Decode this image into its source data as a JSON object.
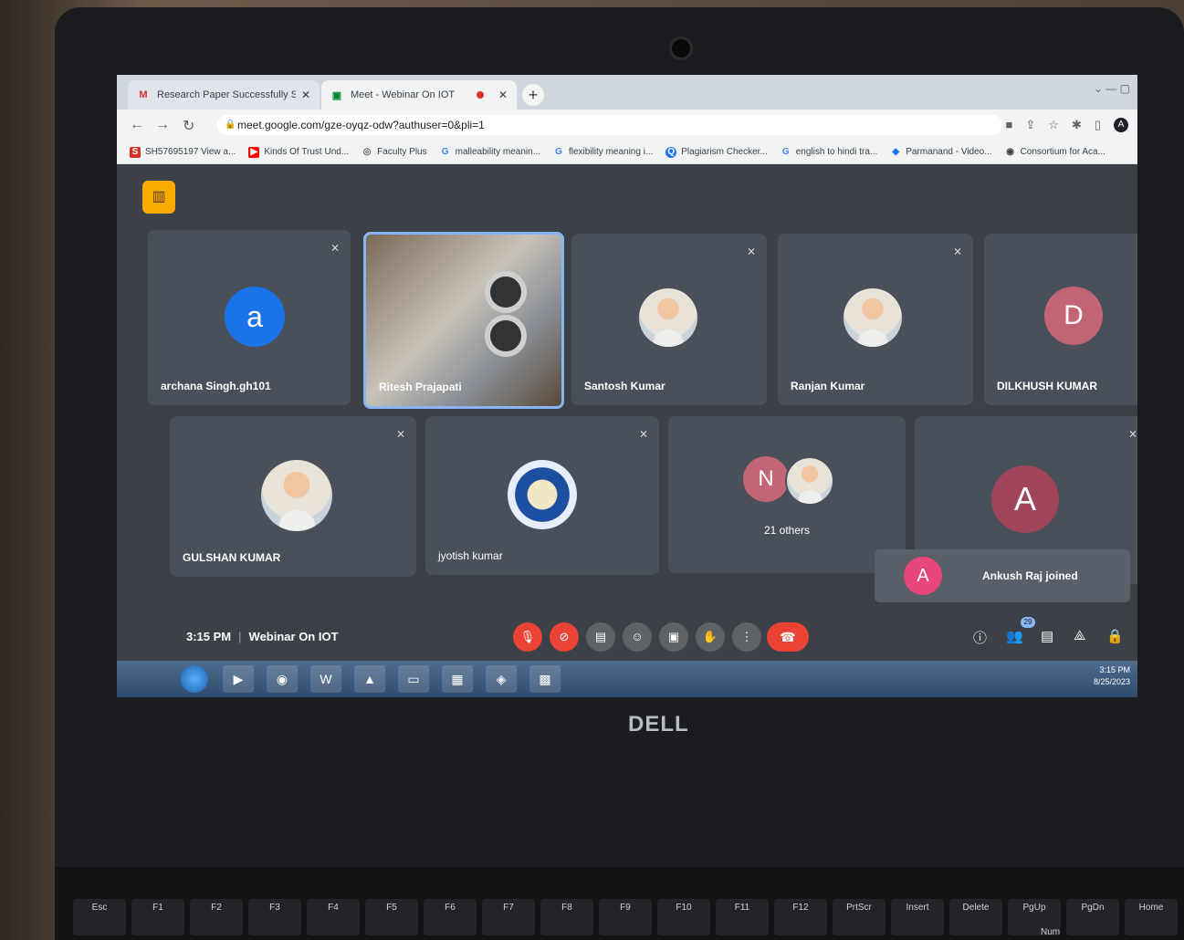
{
  "browser": {
    "tabs": [
      {
        "title": "Research Paper Successfully Sub",
        "icon": "gmail-icon",
        "active": false
      },
      {
        "title": "Meet - Webinar On IOT",
        "icon": "meet-icon",
        "active": true
      }
    ],
    "url": "meet.google.com/gze-oyqz-odw?authuser=0&pli=1",
    "profile_initial": "A",
    "bookmarks": [
      "SH57695197 View a...",
      "Kinds Of Trust Und...",
      "Faculty Plus",
      "malleability meanin...",
      "flexibility meaning i...",
      "Plagiarism Checker...",
      "english to hindi tra...",
      "Parmanand - Video...",
      "Consortium for Aca..."
    ]
  },
  "meet": {
    "participants": [
      {
        "name": "archana Singh.gh101",
        "initial": "a",
        "color": "#1a73e8"
      },
      {
        "name": "Ritesh Prajapati",
        "video": true
      },
      {
        "name": "Santosh Kumar",
        "photo": true
      },
      {
        "name": "Ranjan Kumar",
        "photo": true
      },
      {
        "name": "DILKHUSH KUMAR",
        "initial": "D",
        "color": "#c26577"
      },
      {
        "name": "GULSHAN KUMAR",
        "photo": true
      },
      {
        "name": "jyotish kumar",
        "photo": true
      },
      {
        "name": "21 others",
        "initial": "N",
        "color": "#c26577"
      },
      {
        "name": "",
        "initial": "A",
        "color": "#a0455a"
      }
    ],
    "toast": {
      "initial": "A",
      "text": "Ankush Raj joined",
      "color": "#e8457a"
    },
    "time": "3:15 PM",
    "meeting_title": "Webinar On IOT",
    "people_count": "29"
  },
  "taskbar": {
    "time": "3:15 PM",
    "date": "8/25/2023"
  },
  "laptop": {
    "brand": "DELL",
    "keys": [
      "Esc",
      "F1",
      "F2",
      "F3",
      "F4",
      "F5",
      "F6",
      "F7",
      "F8",
      "F9",
      "F10",
      "F11",
      "F12",
      "PrtScr",
      "Insert",
      "Delete",
      "PgUp",
      "PgDn",
      "Home"
    ],
    "num_label": "Num"
  }
}
